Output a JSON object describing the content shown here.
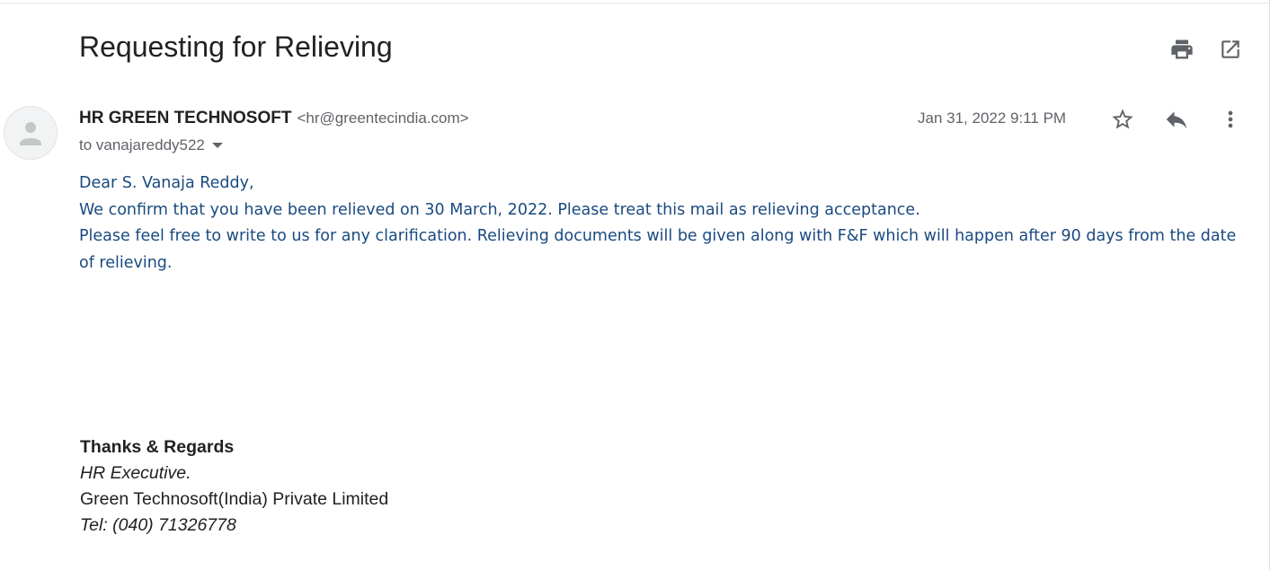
{
  "email": {
    "subject": "Requesting for Relieving",
    "sender": {
      "name": "HR GREEN TECHNOSOFT",
      "email": "<hr@greentecindia.com>"
    },
    "recipient_line": "to vanajareddy522",
    "date": "Jan 31, 2022 9:11 PM",
    "body": [
      "Dear S. Vanaja Reddy,",
      "We confirm that you have been relieved on 30 March, 2022. Please treat this mail as relieving acceptance.",
      "Please feel free to write to us for any clarification. Relieving documents will be given along with F&F which will happen after 90 days from the date of relieving."
    ],
    "signature": {
      "closing": "Thanks & Regards",
      "title": "HR Executive.",
      "company": "Green Technosoft(India) Private Limited",
      "phone": "Tel: (040) 71326778"
    }
  },
  "icons": {
    "top": [
      "print-icon",
      "open-in-new-window-icon"
    ],
    "header": [
      "star-icon",
      "reply-icon",
      "more-options-icon"
    ],
    "avatar": "default-avatar-icon"
  },
  "colors": {
    "body_text": "#1a4a80",
    "icon": "#5f6368",
    "title": "#202124"
  }
}
